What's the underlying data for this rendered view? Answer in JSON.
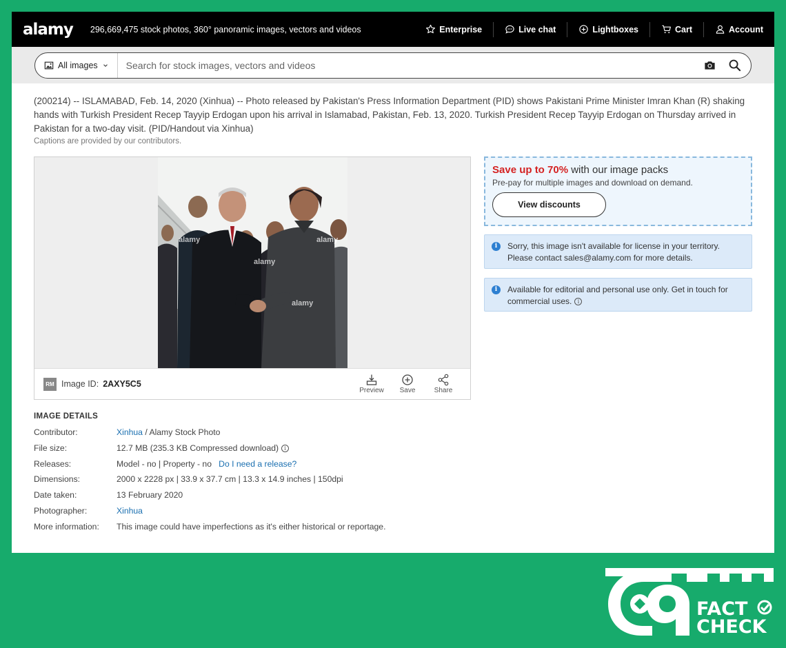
{
  "header": {
    "logo": "alamy",
    "tagline": "296,669,475 stock photos, 360° panoramic images, vectors and videos",
    "nav": [
      {
        "label": "Enterprise",
        "icon": "star-icon"
      },
      {
        "label": "Live chat",
        "icon": "chat-icon"
      },
      {
        "label": "Lightboxes",
        "icon": "plus-circle-icon"
      },
      {
        "label": "Cart",
        "icon": "cart-icon"
      },
      {
        "label": "Account",
        "icon": "user-icon"
      }
    ]
  },
  "search": {
    "filter_label": "All images",
    "placeholder": "Search for stock images, vectors and videos"
  },
  "caption": {
    "text": "(200214) -- ISLAMABAD, Feb. 14, 2020 (Xinhua) -- Photo released by Pakistan's Press Information Department (PID) shows Pakistani Prime Minister Imran Khan (R) shaking hands with Turkish President Recep Tayyip Erdogan upon his arrival in Islamabad, Pakistan, Feb. 13, 2020. Turkish President Recep Tayyip Erdogan on Thursday arrived in Pakistan for a two-day visit. (PID/Handout via Xinhua)",
    "note": "Captions are provided by our contributors."
  },
  "image": {
    "badge": "RM",
    "id_label": "Image ID:",
    "id": "2AXY5C5",
    "watermark": "alamy",
    "actions": [
      {
        "label": "Preview",
        "icon": "preview-icon"
      },
      {
        "label": "Save",
        "icon": "save-icon"
      },
      {
        "label": "Share",
        "icon": "share-icon"
      }
    ]
  },
  "promo": {
    "highlight": "Save up to 70%",
    "title_rest": " with our image packs",
    "sub": "Pre-pay for multiple images and download on demand.",
    "button": "View discounts"
  },
  "notices": [
    "Sorry, this image isn't available for license in your territory. Please contact sales@alamy.com for more details.",
    "Available for editorial and personal use only. Get in touch for commercial uses."
  ],
  "details": {
    "title": "IMAGE DETAILS",
    "contributor_label": "Contributor:",
    "contributor_link": "Xinhua",
    "contributor_rest": " / Alamy Stock Photo",
    "filesize_label": "File size:",
    "filesize": "12.7 MB (235.3 KB Compressed download)",
    "releases_label": "Releases:",
    "releases": "Model - no | Property - no",
    "releases_link": "Do I need a release?",
    "dimensions_label": "Dimensions:",
    "dimensions": "2000 x 2228 px | 33.9 x 37.7 cm | 13.3 x 14.9 inches | 150dpi",
    "date_label": "Date taken:",
    "date": "13 February 2020",
    "photographer_label": "Photographer:",
    "photographer": "Xinhua",
    "more_label": "More information:",
    "more": "This image could have imperfections as it's either historical or reportage."
  },
  "factcheck": {
    "line1": "FACT",
    "line2": "CHECK"
  }
}
